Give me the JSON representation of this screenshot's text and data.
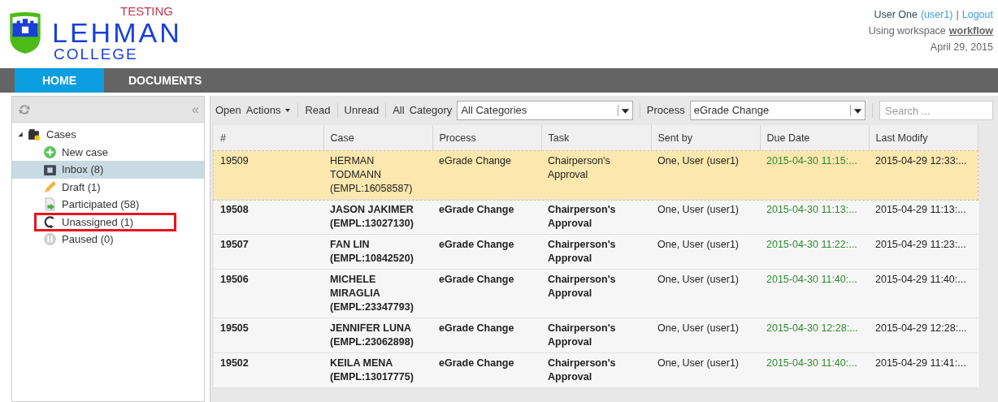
{
  "header": {
    "logo": {
      "name": "LEHMAN",
      "sub": "COLLEGE",
      "badge": "TESTING"
    },
    "user": {
      "name": "User One",
      "username": "(user1)",
      "separator": "|",
      "logout": "Logout",
      "workspace_label": "Using workspace",
      "workspace": "workflow",
      "date": "April 29, 2015"
    }
  },
  "nav": [
    {
      "label": "HOME",
      "selected": true
    },
    {
      "label": "DOCUMENTS",
      "selected": false
    }
  ],
  "sidebar": {
    "collapse": "«",
    "tree": [
      {
        "label": "Cases",
        "kind": "cases",
        "expanded": true,
        "selected": false,
        "highlighted": false,
        "children": [
          {
            "label": "New case",
            "kind": "new",
            "selected": false,
            "highlighted": false
          },
          {
            "label": "Inbox (8)",
            "kind": "inbox",
            "selected": true,
            "highlighted": false
          },
          {
            "label": "Draft (1)",
            "kind": "draft",
            "selected": false,
            "highlighted": false
          },
          {
            "label": "Participated (58)",
            "kind": "participated",
            "selected": false,
            "highlighted": false
          },
          {
            "label": "Unassigned (1)",
            "kind": "unassigned",
            "selected": false,
            "highlighted": true
          },
          {
            "label": "Paused (0)",
            "kind": "paused",
            "selected": false,
            "highlighted": false
          }
        ]
      }
    ]
  },
  "toolbar": {
    "open": "Open",
    "actions": "Actions",
    "read": "Read",
    "unread": "Unread",
    "all": "All",
    "category_label": "Category",
    "category": "All Categories",
    "process_label": "Process",
    "process": "eGrade Change",
    "search_placeholder": "Search ..."
  },
  "table": {
    "columns": [
      "#",
      "Case",
      "Process",
      "Task",
      "Sent by",
      "Due Date",
      "Last Modify"
    ],
    "rows": [
      {
        "selected": true,
        "unread": false,
        "cells": [
          "19509",
          "HERMAN TODMANN (EMPL:16058587)",
          "eGrade Change",
          "Chairperson's Approval",
          "One, User (user1)",
          "2015-04-30 11:15:...",
          "2015-04-29 12:33:..."
        ]
      },
      {
        "selected": false,
        "unread": true,
        "cells": [
          "19508",
          "JASON JAKIMER (EMPL:13027130)",
          "eGrade Change",
          "Chairperson's Approval",
          "One, User (user1)",
          "2015-04-30 11:13:...",
          "2015-04-29 11:13:..."
        ]
      },
      {
        "selected": false,
        "unread": true,
        "cells": [
          "19507",
          "FAN LIN (EMPL:10842520)",
          "eGrade Change",
          "Chairperson's Approval",
          "One, User (user1)",
          "2015-04-30 11:22:...",
          "2015-04-29 11:23:..."
        ]
      },
      {
        "selected": false,
        "unread": true,
        "cells": [
          "19506",
          "MICHELE MIRAGLIA (EMPL:23347793)",
          "eGrade Change",
          "Chairperson's Approval",
          "One, User (user1)",
          "2015-04-30 11:40:...",
          "2015-04-29 11:40:..."
        ]
      },
      {
        "selected": false,
        "unread": true,
        "cells": [
          "19505",
          "JENNIFER LUNA (EMPL:23062898)",
          "eGrade Change",
          "Chairperson's Approval",
          "One, User (user1)",
          "2015-04-30 12:28:...",
          "2015-04-29 12:28:..."
        ]
      },
      {
        "selected": false,
        "unread": true,
        "cells": [
          "19502",
          "KEILA MENA (EMPL:13017775)",
          "eGrade Change",
          "Chairperson's Approval",
          "One, User (user1)",
          "2015-04-30 11:40:...",
          "2015-04-29 11:41:..."
        ]
      }
    ]
  }
}
